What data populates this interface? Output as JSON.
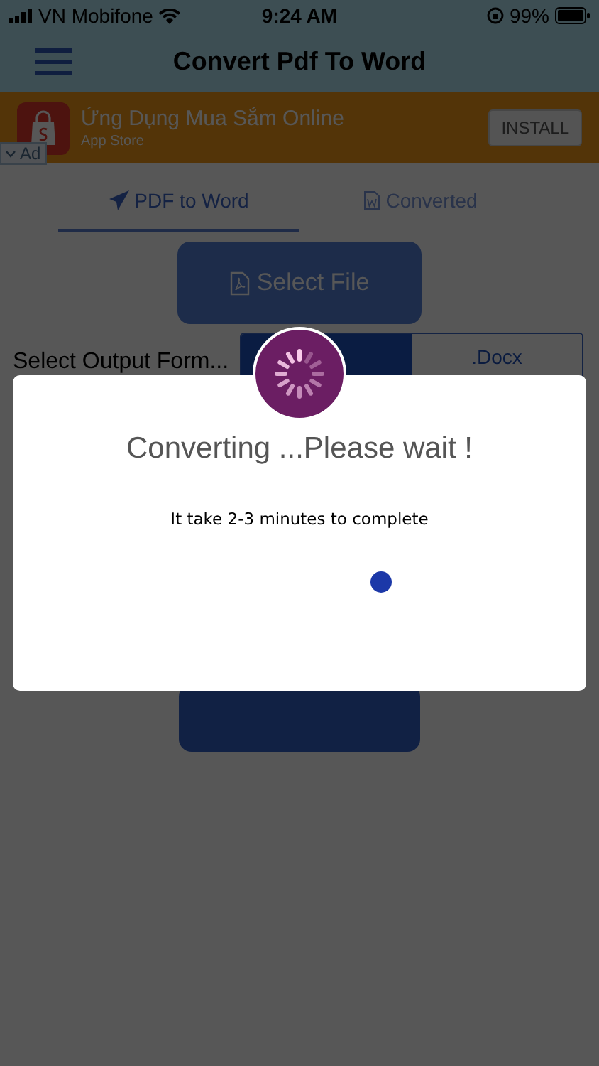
{
  "status_bar": {
    "carrier": "VN Mobifone",
    "time": "9:24 AM",
    "battery": "99%"
  },
  "nav_bar": {
    "title": "Convert Pdf To Word"
  },
  "ad": {
    "title": "Ứng Dụng Mua Sắm Online",
    "subtitle": "App Store",
    "install": "INSTALL",
    "badge": "Ad"
  },
  "tabs": [
    {
      "label": "PDF to Word",
      "kind": "send",
      "selected": true
    },
    {
      "label": "Converted",
      "kind": "doc",
      "selected": false
    }
  ],
  "select_file": {
    "label": "Select File"
  },
  "output_format": {
    "label": "Select Output Form...",
    "options": [
      {
        "selected": true
      },
      {
        "label": ".Docx",
        "selected": false
      }
    ]
  },
  "dialog": {
    "title": "Converting ...Please wait !",
    "message": "It take 2-3 minutes to complete"
  }
}
